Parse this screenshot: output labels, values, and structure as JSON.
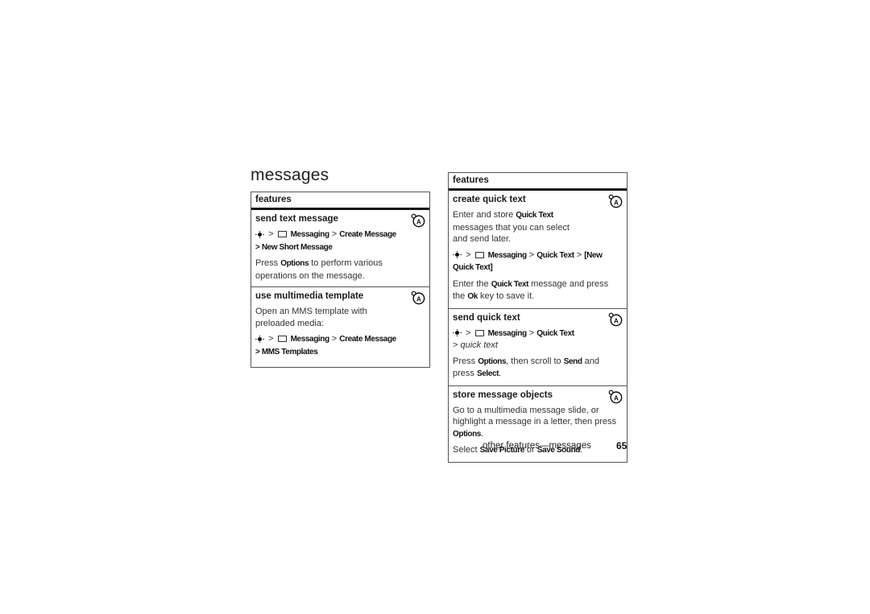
{
  "page": {
    "heading": "messages",
    "footer_section": "other features—messages",
    "page_number": "65"
  },
  "left_table": {
    "header": "features",
    "rows": [
      {
        "title": "send text message",
        "icon": "network-operator-icon",
        "path": {
          "sep": ">",
          "parts": [
            "Messaging",
            ">",
            "Create Message"
          ],
          "line2": "> New Short Message"
        },
        "text": {
          "pre": "Press ",
          "cmd": "Options",
          "post": " to perform various operations on the message."
        }
      },
      {
        "title": "use multimedia template",
        "icon": "network-operator-icon",
        "desc": "Open an MMS template with preloaded media:",
        "path": {
          "sep": ">",
          "parts": [
            "Messaging",
            ">",
            "Create Message"
          ],
          "line2": "> MMS Templates"
        }
      }
    ]
  },
  "right_table": {
    "header": "features",
    "rows": [
      {
        "title": "create quick text",
        "icon": "network-operator-icon",
        "desc": {
          "pre": "Enter and store ",
          "cmd": "Quick Text",
          "post": " messages that you can select and send later."
        },
        "path": {
          "sep": ">",
          "parts": [
            "Messaging",
            ">",
            "Quick Text",
            ">",
            "[New Quick Text]"
          ]
        },
        "text": {
          "pre": "Enter the ",
          "cmd": "Quick Text",
          "mid": " message and press the ",
          "cmd2": "Ok",
          "post": " key to save it."
        }
      },
      {
        "title": "send quick text",
        "icon": "network-operator-icon",
        "path": {
          "sep": ">",
          "parts": [
            "Messaging",
            ">",
            "Quick Text"
          ],
          "line2_prefix": "> ",
          "line2_italic": "quick text"
        },
        "text": {
          "pre": "Press ",
          "cmd": "Options",
          "mid": ", then scroll to ",
          "cmd2": "Send",
          "mid2": " and press ",
          "cmd3": "Select",
          "post": "."
        }
      },
      {
        "title": "store message objects",
        "icon": "network-operator-icon",
        "desc": {
          "pre": "Go to a multimedia message slide, or highlight a message in a letter, then press ",
          "cmd": "Options",
          "post": "."
        },
        "text": {
          "pre": "Select ",
          "cmd": "Save Picture",
          "mid": " or ",
          "cmd2": "Save Sound",
          "post": "."
        }
      }
    ]
  }
}
